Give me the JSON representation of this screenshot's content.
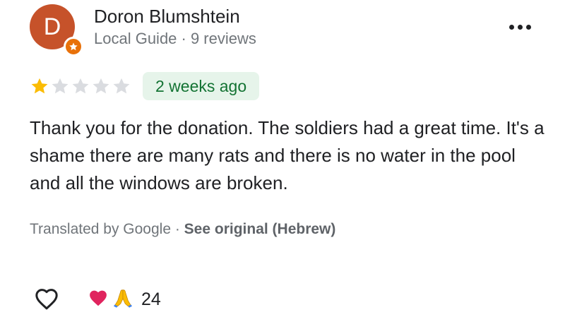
{
  "reviewer": {
    "initial": "D",
    "name": "Doron Blumshtein",
    "meta": "Local Guide · 9 reviews",
    "avatar_color": "#c6522a",
    "badge_icon": "local-guide-star-icon"
  },
  "review": {
    "rating": 1,
    "rating_max": 5,
    "time": "2 weeks ago",
    "text": "Thank you for the donation. The soldiers had a great time. It's a shame there are many rats and there is no water in the pool and all the windows are broken.",
    "translation_note": "Translated by Google · ",
    "see_original": "See original (Hebrew)"
  },
  "reactions": {
    "emoji": [
      "heart-emoji",
      "folded-hands-emoji"
    ],
    "count": "24"
  },
  "colors": {
    "star_filled": "#fbbc04",
    "star_empty": "#dadce0",
    "time_badge_bg": "#e6f4ea",
    "time_badge_text": "#137333"
  },
  "icons": {
    "more": "more-options-icon",
    "like": "heart-outline-icon"
  }
}
